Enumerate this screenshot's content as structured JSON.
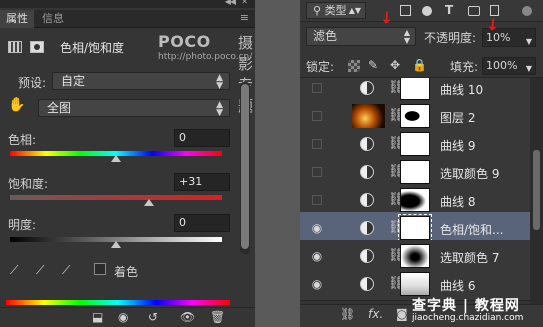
{
  "left_panel": {
    "tabs": [
      "属性",
      "信息"
    ],
    "panel_title": "色相/饱和度",
    "watermark_poco": "POCO",
    "watermark_cn": "摄影专题",
    "watermark_url": "http://photo.poco.cn/",
    "preset_label": "预设:",
    "preset_value": "自定",
    "channel_value": "全图",
    "hue_label": "色相:",
    "hue_value": "0",
    "saturation_label": "饱和度:",
    "saturation_value": "+31",
    "lightness_label": "明度:",
    "lightness_value": "0",
    "colorize_label": "着色",
    "sliders": {
      "hue_level": 0.5,
      "saturation_level": 0.655,
      "lightness_level": 0.5
    }
  },
  "right_panel": {
    "filter_kind": "类型",
    "blend_mode": "滤色",
    "opacity_label": "不透明度:",
    "opacity_value": "10%",
    "lock_label": "锁定:",
    "fill_label": "填充:",
    "fill_value": "100%",
    "layers": [
      {
        "name": "曲线 10",
        "visible": false,
        "kind": "adjust",
        "mask": "white",
        "selected": false
      },
      {
        "name": "图层 2",
        "visible": false,
        "kind": "image",
        "mask": "m2",
        "selected": false
      },
      {
        "name": "曲线 9",
        "visible": false,
        "kind": "adjust",
        "mask": "white",
        "selected": false
      },
      {
        "name": "选取颜色 9",
        "visible": false,
        "kind": "adjust",
        "mask": "white",
        "selected": false
      },
      {
        "name": "曲线 8",
        "visible": false,
        "kind": "adjust",
        "mask": "m8",
        "selected": false
      },
      {
        "name": "色相/饱和...",
        "visible": true,
        "kind": "adjust",
        "mask": "white",
        "selected": true
      },
      {
        "name": "选取颜色 7",
        "visible": true,
        "kind": "adjust",
        "mask": "m7",
        "selected": false
      },
      {
        "name": "曲线 6",
        "visible": true,
        "kind": "adjust",
        "mask": "m6",
        "selected": false
      }
    ],
    "footer_fx": "fx.",
    "watermark_cn": "查字典",
    "watermark_sub": "教程网",
    "watermark_url": "jiaocheng.chazidian.com"
  },
  "colors": {
    "accent_arrow": "#e21b1b",
    "selected_row": "#59647a"
  }
}
